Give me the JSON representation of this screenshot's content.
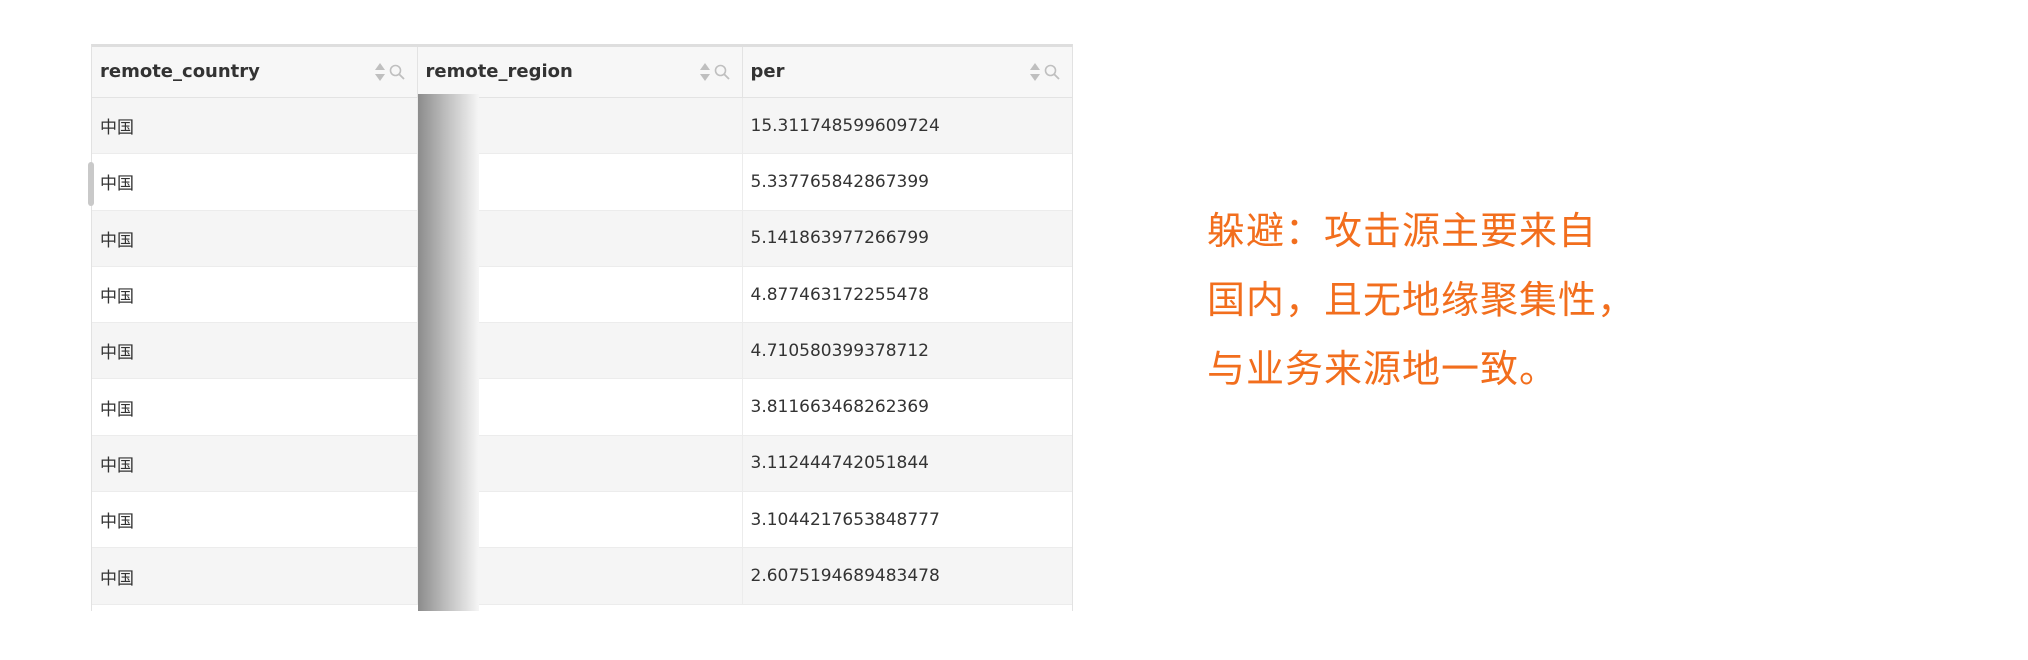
{
  "table": {
    "columns": [
      {
        "label": "remote_country",
        "sort_icon": "sort-icon",
        "filter_icon": "search-icon"
      },
      {
        "label": "remote_region",
        "sort_icon": "sort-icon",
        "filter_icon": "search-icon"
      },
      {
        "label": "per",
        "sort_icon": "sort-icon",
        "filter_icon": "search-icon"
      }
    ],
    "rows": [
      {
        "remote_country": "中国",
        "remote_region": "",
        "per": "15.311748599609724"
      },
      {
        "remote_country": "中国",
        "remote_region": "",
        "per": "5.337765842867399"
      },
      {
        "remote_country": "中国",
        "remote_region": "",
        "per": "5.141863977266799"
      },
      {
        "remote_country": "中国",
        "remote_region": "",
        "per": "4.877463172255478"
      },
      {
        "remote_country": "中国",
        "remote_region": "",
        "per": "4.710580399378712"
      },
      {
        "remote_country": "中国",
        "remote_region": "",
        "per": "3.811663468262369"
      },
      {
        "remote_country": "中国",
        "remote_region": "",
        "per": "3.112444742051844"
      },
      {
        "remote_country": "中国",
        "remote_region": "",
        "per": "3.1044217653848777"
      },
      {
        "remote_country": "中国",
        "remote_region": "",
        "per": "2.6075194689483478"
      }
    ]
  },
  "note": {
    "lines": [
      "躲避：攻击源主要来自",
      "国内，且无地缘聚集性，",
      "与业务来源地一致。"
    ],
    "color": "#f26e1d"
  },
  "colors": {
    "header_bg": "#f7f7f7",
    "row_alt_bg": "#f5f5f5",
    "text": "#333333"
  }
}
